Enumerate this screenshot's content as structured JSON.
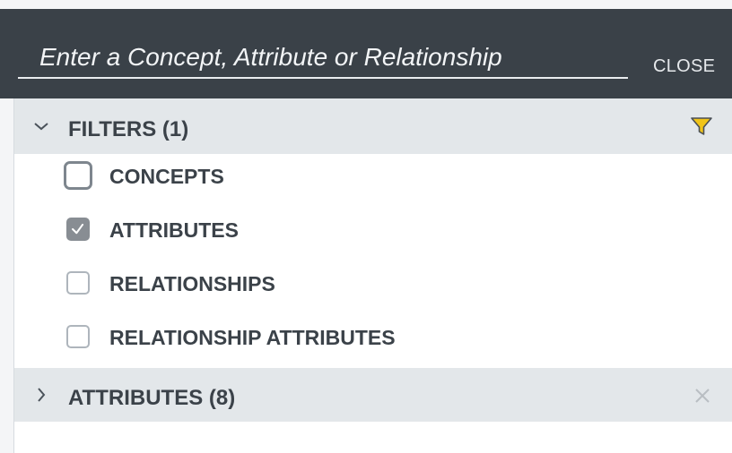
{
  "search": {
    "placeholder": "Enter a Concept, Attribute or Relationship",
    "value": ""
  },
  "header": {
    "close_label": "CLOSE"
  },
  "filters": {
    "title": "FILTERS (1)",
    "expanded": true,
    "options": [
      {
        "label": "CONCEPTS",
        "checked": false
      },
      {
        "label": "ATTRIBUTES",
        "checked": true
      },
      {
        "label": "RELATIONSHIPS",
        "checked": false
      },
      {
        "label": "RELATIONSHIP ATTRIBUTES",
        "checked": false
      }
    ]
  },
  "attributes_section": {
    "title": "ATTRIBUTES (8)",
    "expanded": false
  },
  "colors": {
    "header_bg": "#3a4148",
    "section_bg": "#e3e7ea",
    "filter_icon": "#f0c419"
  },
  "icons": {
    "filters_chevron": "chevron-down-icon",
    "attributes_chevron": "chevron-right-icon",
    "filter": "filter-icon",
    "clear": "close-icon"
  }
}
